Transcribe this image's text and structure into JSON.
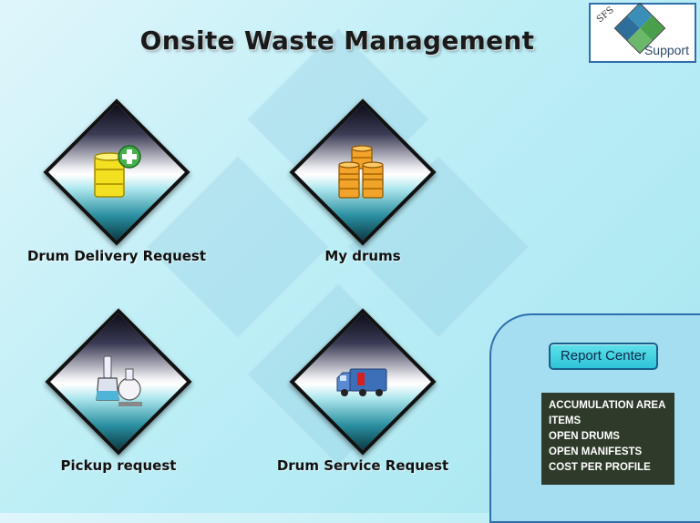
{
  "page": {
    "title": "Onsite Waste Management"
  },
  "support_logo": {
    "label": "Support",
    "mark": "SFS"
  },
  "tiles": [
    {
      "label": "Drum Delivery Request",
      "icon": "yellow-drum-plus-icon"
    },
    {
      "label": "My drums",
      "icon": "stacked-drums-icon"
    },
    {
      "label": "Pickup request",
      "icon": "lab-flask-icon"
    },
    {
      "label": "Drum Service Request",
      "icon": "delivery-truck-icon"
    }
  ],
  "report": {
    "button_label": "Report Center",
    "links": [
      "ACCUMULATION AREA",
      "ITEMS",
      "OPEN DRUMS",
      "OPEN MANIFESTS",
      "COST PER PROFILE"
    ]
  },
  "colors": {
    "background": "#bdeef6",
    "panel": "#a5def0",
    "panel_border": "#2f6fae",
    "report_list_bg": "#2e3b2a",
    "button": "#2fc4d8"
  }
}
